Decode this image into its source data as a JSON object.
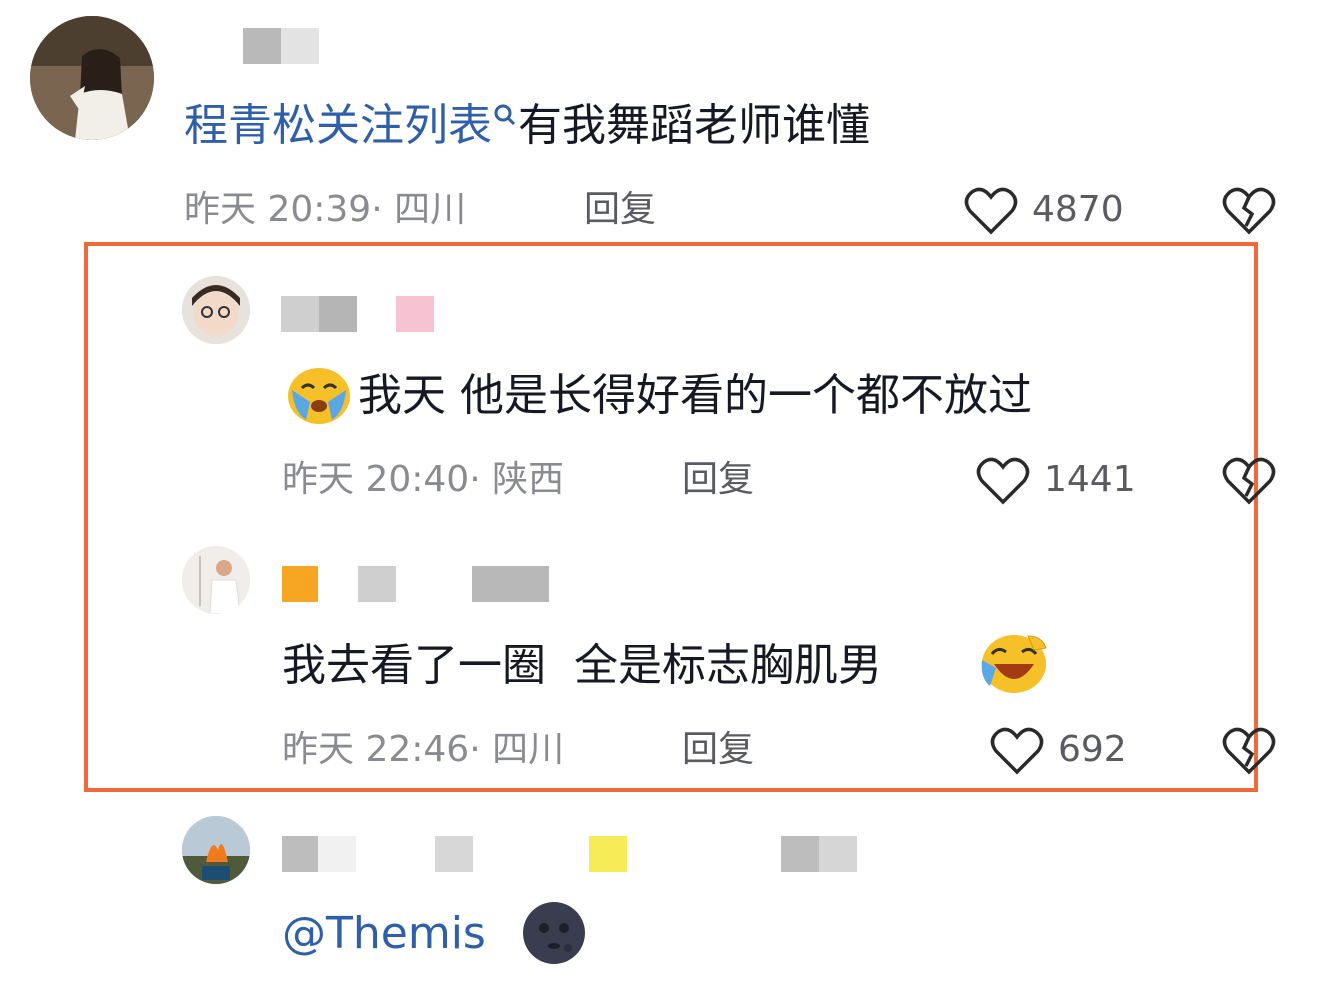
{
  "comments": [
    {
      "username_hidden": true,
      "link_text": "程青松关注列表",
      "text": "有我舞蹈老师谁懂",
      "time": "昨天 20:39",
      "location": "· 四川",
      "reply": "回复",
      "likes": "4870"
    },
    {
      "username_hidden": true,
      "text": "我天 他是长得好看的一个都不放过",
      "emoji_before": "crying-face-emoji",
      "time": "昨天 20:40",
      "location": "· 陕西",
      "reply": "回复",
      "likes": "1441"
    },
    {
      "username_hidden": true,
      "text": "我去看了一圈  全是标志胸肌男",
      "emoji_after": "laughing-crying-emoji",
      "time": "昨天 22:46",
      "location": "· 四川",
      "reply": "回复",
      "likes": "692"
    },
    {
      "username_hidden": true,
      "mention": "@Themis",
      "emoji_after": "dark-moon-face-emoji"
    }
  ],
  "colors": {
    "highlight_border": "#ef6a3a",
    "link": "#2f5fa8",
    "meta": "#8a8b91"
  }
}
